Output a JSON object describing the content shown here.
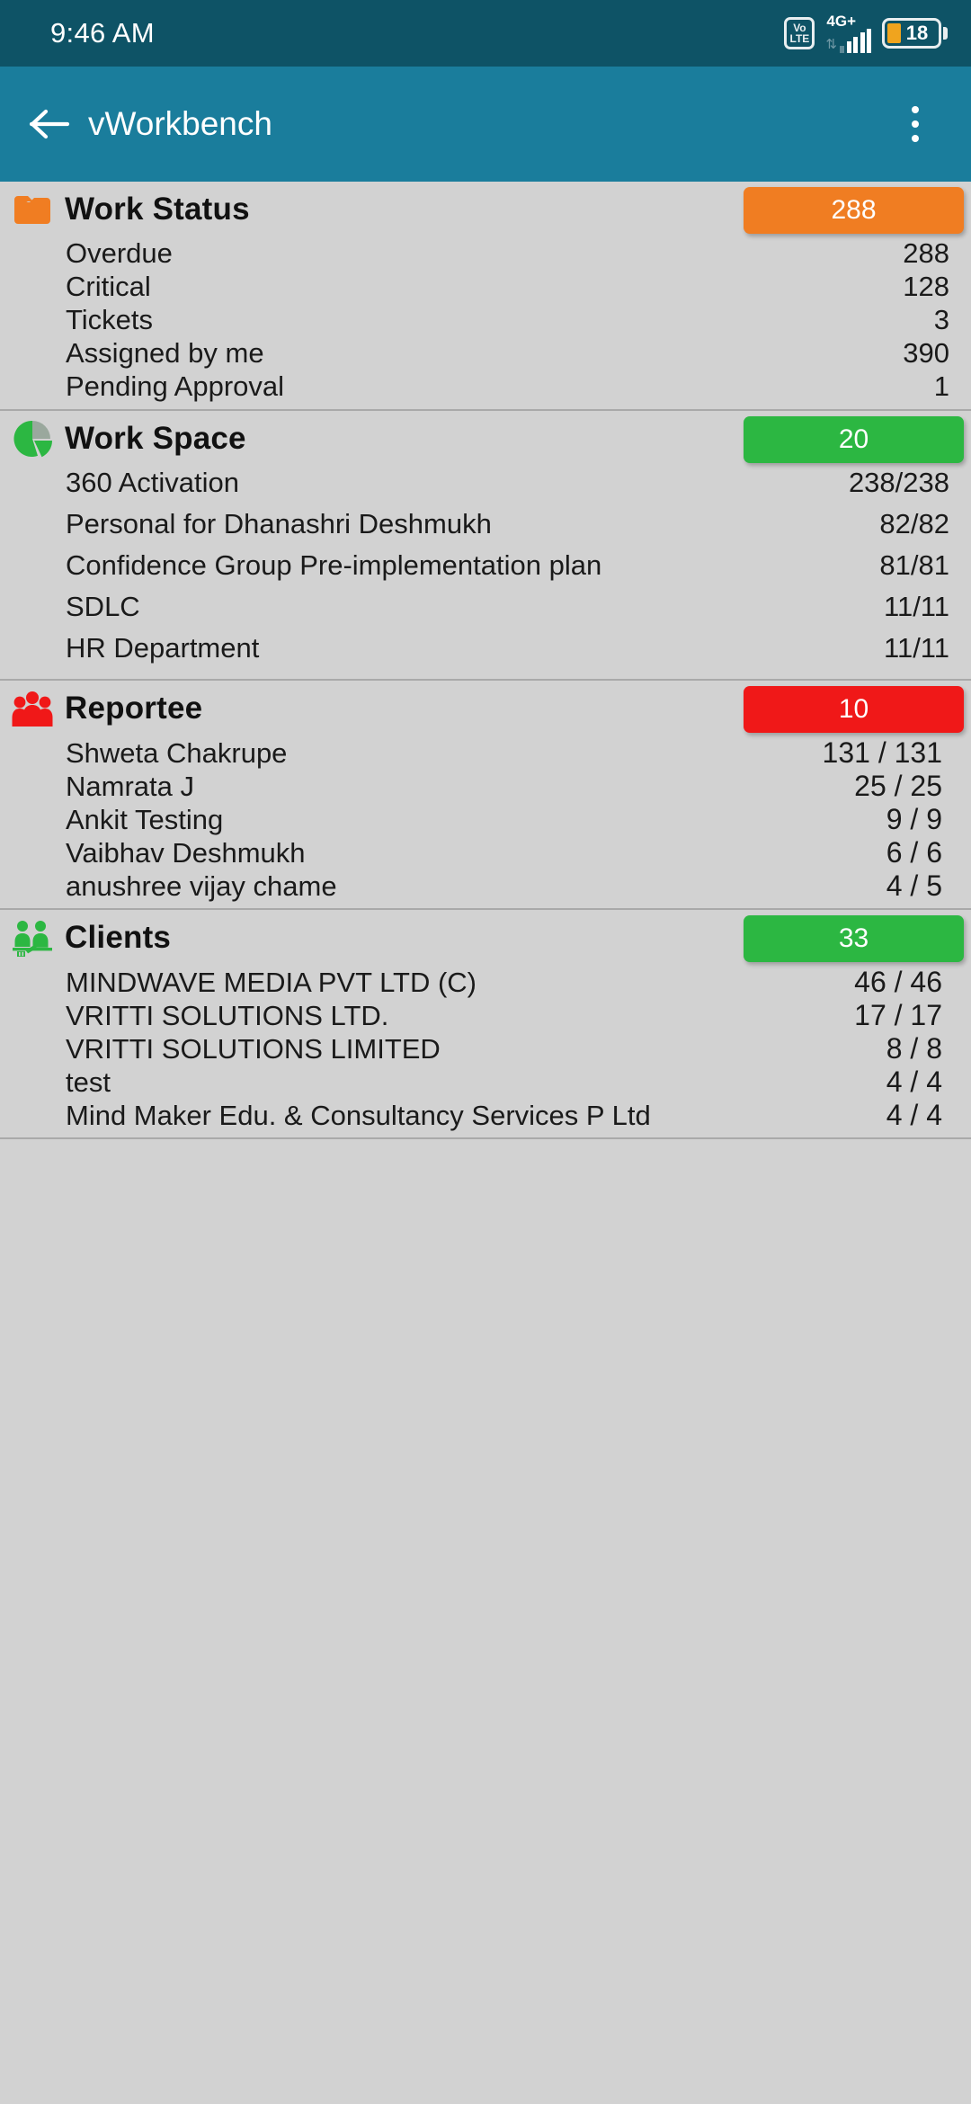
{
  "status_bar": {
    "time": "9:46 AM",
    "volte_top": "Vo",
    "volte_bottom": "LTE",
    "network_label": "4G+",
    "battery_level": "18",
    "icons": [
      "volte-icon",
      "signal-bars-icon",
      "battery-icon"
    ]
  },
  "app_bar": {
    "back_icon": "arrow-back-icon",
    "title": "vWorkbench",
    "overflow_icon": "more-vertical-icon"
  },
  "colors": {
    "status_bar_bg": "#0e5366",
    "app_bar_bg": "#1a7d9c",
    "page_bg": "#d2d2d2",
    "orange": "#f07d22",
    "green": "#2cb742",
    "red": "#f01818",
    "battery_fill": "#f0a41e"
  },
  "sections": [
    {
      "id": "work-status",
      "title": "Work Status",
      "icon": "folder-icon",
      "badge": "288",
      "badge_color": "#f07d22",
      "rows": [
        {
          "label": "Overdue",
          "value": "288"
        },
        {
          "label": "Critical",
          "value": "128"
        },
        {
          "label": "Tickets",
          "value": "3"
        },
        {
          "label": "Assigned by me",
          "value": "390"
        },
        {
          "label": "Pending Approval",
          "value": "1"
        }
      ]
    },
    {
      "id": "work-space",
      "title": "Work Space",
      "icon": "pie-chart-icon",
      "badge": "20",
      "badge_color": "#2cb742",
      "rows": [
        {
          "label": "360 Activation",
          "value": "238/238"
        },
        {
          "label": "Personal for Dhanashri Deshmukh",
          "value": "82/82"
        },
        {
          "label": "Confidence Group Pre-implementation plan",
          "value": "81/81"
        },
        {
          "label": "SDLC",
          "value": "11/11"
        },
        {
          "label": "HR Department",
          "value": "11/11"
        }
      ]
    },
    {
      "id": "reportee",
      "title": "Reportee",
      "icon": "people-group-icon",
      "badge": "10",
      "badge_color": "#f01818",
      "rows": [
        {
          "label": "Shweta Chakrupe",
          "value": "131 / 131"
        },
        {
          "label": "Namrata J",
          "value": "25 / 25"
        },
        {
          "label": "Ankit Testing",
          "value": "9 / 9"
        },
        {
          "label": "Vaibhav Deshmukh",
          "value": "6 / 6"
        },
        {
          "label": "anushree vijay chame",
          "value": "4 / 5"
        }
      ]
    },
    {
      "id": "clients",
      "title": "Clients",
      "icon": "clients-meeting-icon",
      "badge": "33",
      "badge_color": "#2cb742",
      "rows": [
        {
          "label": "MINDWAVE MEDIA PVT LTD (C)",
          "value": "46 / 46"
        },
        {
          "label": "VRITTI SOLUTIONS LTD.",
          "value": "17 / 17"
        },
        {
          "label": "VRITTI SOLUTIONS LIMITED",
          "value": "8 / 8"
        },
        {
          "label": "test",
          "value": "4 / 4"
        },
        {
          "label": "Mind Maker Edu. & Consultancy Services P Ltd",
          "value": "4 / 4"
        }
      ]
    }
  ]
}
